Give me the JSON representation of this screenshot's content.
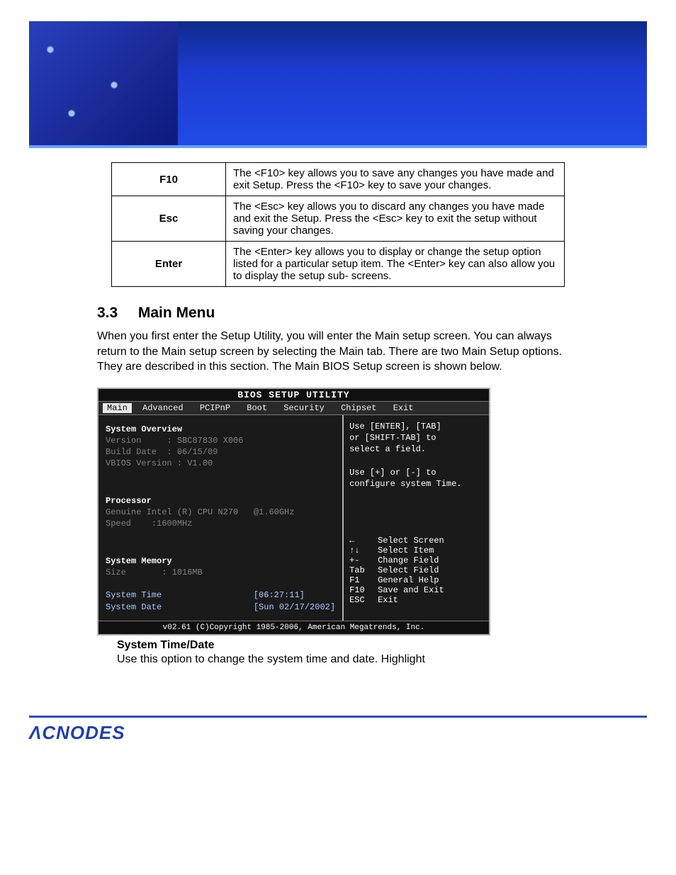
{
  "keys_table": [
    {
      "name": "F10",
      "desc": "The <F10> key allows you to save any changes you have made and exit Setup. Press the <F10> key to save your changes."
    },
    {
      "name": "Esc",
      "desc": "The <Esc> key allows you to discard any changes you have made and exit the Setup. Press the <Esc> key to exit the setup without saving your changes."
    },
    {
      "name": "Enter",
      "desc": "The <Enter> key allows you to display or change the setup option listed for a particular setup item. The <Enter> key can also allow you to display the setup sub- screens."
    }
  ],
  "section": {
    "number": "3.3",
    "title": "Main Menu",
    "intro": "When you first enter the Setup Utility, you will enter the Main setup screen. You can always return to the Main setup screen by selecting the Main tab. There are two Main Setup options. They are described in this section. The Main BIOS Setup screen is shown below."
  },
  "bios": {
    "title": "BIOS SETUP UTILITY",
    "tabs": [
      "Main",
      "Advanced",
      "PCIPnP",
      "Boot",
      "Security",
      "Chipset",
      "Exit"
    ],
    "selected_tab_index": 0,
    "overview_heading": "System Overview",
    "version_label": "Version",
    "version_value": "SBC87830 X006",
    "build_label": "Build Date",
    "build_value": "06/15/09",
    "vbios_label": "VBIOS Version",
    "vbios_value": "V1.00",
    "processor_heading": "Processor",
    "processor_name": "Genuine Intel (R) CPU N270   @1.60GHz",
    "speed_label": "Speed",
    "speed_value": "1600MHz",
    "memory_heading": "System Memory",
    "size_label": "Size",
    "size_value": "1016MB",
    "time_label": "System Time",
    "time_value": "[06:27:11]",
    "date_label": "System Date",
    "date_value": "[Sun 02/17/2002]",
    "help1": "Use [ENTER], [TAB]",
    "help2": "or [SHIFT-TAB] to",
    "help3": "select a field.",
    "help4": "Use [+] or [-] to",
    "help5": "configure system Time.",
    "nav": [
      {
        "key": "←    ",
        "label": "Select Screen"
      },
      {
        "key": "↑↓",
        "label": "Select Item"
      },
      {
        "key": "+-",
        "label": "Change Field"
      },
      {
        "key": "Tab",
        "label": "Select Field"
      },
      {
        "key": "F1",
        "label": "General Help"
      },
      {
        "key": "F10",
        "label": "Save and Exit"
      },
      {
        "key": "ESC",
        "label": "Exit"
      }
    ],
    "copyright": "v02.61 (C)Copyright 1985-2006, American Megatrends, Inc."
  },
  "subsection": {
    "title": "System Time/Date",
    "text": "Use this option to change the system time and date. Highlight"
  },
  "footer_logo": "ΛCNODES"
}
